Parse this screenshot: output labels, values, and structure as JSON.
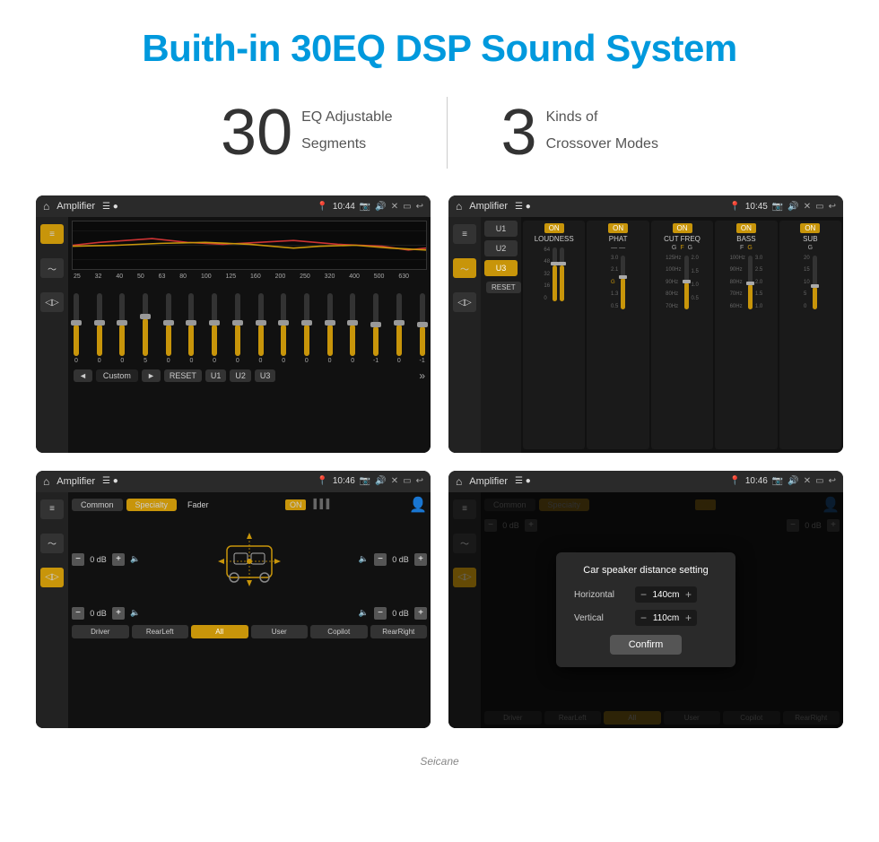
{
  "header": {
    "title": "Buith-in 30EQ DSP Sound System"
  },
  "stats": {
    "eq_number": "30",
    "eq_label_line1": "EQ Adjustable",
    "eq_label_line2": "Segments",
    "crossover_number": "3",
    "crossover_label_line1": "Kinds of",
    "crossover_label_line2": "Crossover Modes"
  },
  "screen1": {
    "title": "Amplifier",
    "time": "10:44",
    "eq_labels": [
      "25",
      "32",
      "40",
      "50",
      "63",
      "80",
      "100",
      "125",
      "160",
      "200",
      "250",
      "320",
      "400",
      "500",
      "630"
    ],
    "eq_values": [
      0,
      0,
      0,
      5,
      0,
      0,
      0,
      0,
      0,
      0,
      0,
      0,
      0,
      -1,
      0,
      -1
    ],
    "bottom_buttons": [
      "◄",
      "Custom",
      "►",
      "RESET",
      "U1",
      "U2",
      "U3"
    ]
  },
  "screen2": {
    "title": "Amplifier",
    "time": "10:45",
    "presets": [
      "U1",
      "U2",
      "U3"
    ],
    "active_preset": "U3",
    "bands": [
      {
        "name": "LOUDNESS",
        "on": true
      },
      {
        "name": "PHAT",
        "on": true
      },
      {
        "name": "CUT FREQ",
        "on": true
      },
      {
        "name": "BASS",
        "on": true
      },
      {
        "name": "SUB",
        "on": true
      }
    ],
    "reset_label": "RESET"
  },
  "screen3": {
    "title": "Amplifier",
    "time": "10:46",
    "tabs": [
      "Common",
      "Specialty"
    ],
    "active_tab": "Specialty",
    "fader_label": "Fader",
    "fader_on": "ON",
    "vol_rows": [
      {
        "label": "0 dB",
        "side": "left"
      },
      {
        "label": "0 dB",
        "side": "left"
      },
      {
        "label": "0 dB",
        "side": "right"
      },
      {
        "label": "0 dB",
        "side": "right"
      }
    ],
    "bottom_buttons": [
      "Driver",
      "RearLeft",
      "All",
      "User",
      "Copilot",
      "RearRight"
    ],
    "active_bottom": "All"
  },
  "screen4": {
    "title": "Amplifier",
    "time": "10:46",
    "tabs": [
      "Common",
      "Specialty"
    ],
    "dialog": {
      "title": "Car speaker distance setting",
      "rows": [
        {
          "label": "Horizontal",
          "value": "140cm"
        },
        {
          "label": "Vertical",
          "value": "110cm"
        }
      ],
      "confirm_label": "Confirm"
    },
    "vol_rows": [
      {
        "label": "0 dB"
      },
      {
        "label": "0 dB"
      }
    ]
  },
  "watermark": "Seicane"
}
